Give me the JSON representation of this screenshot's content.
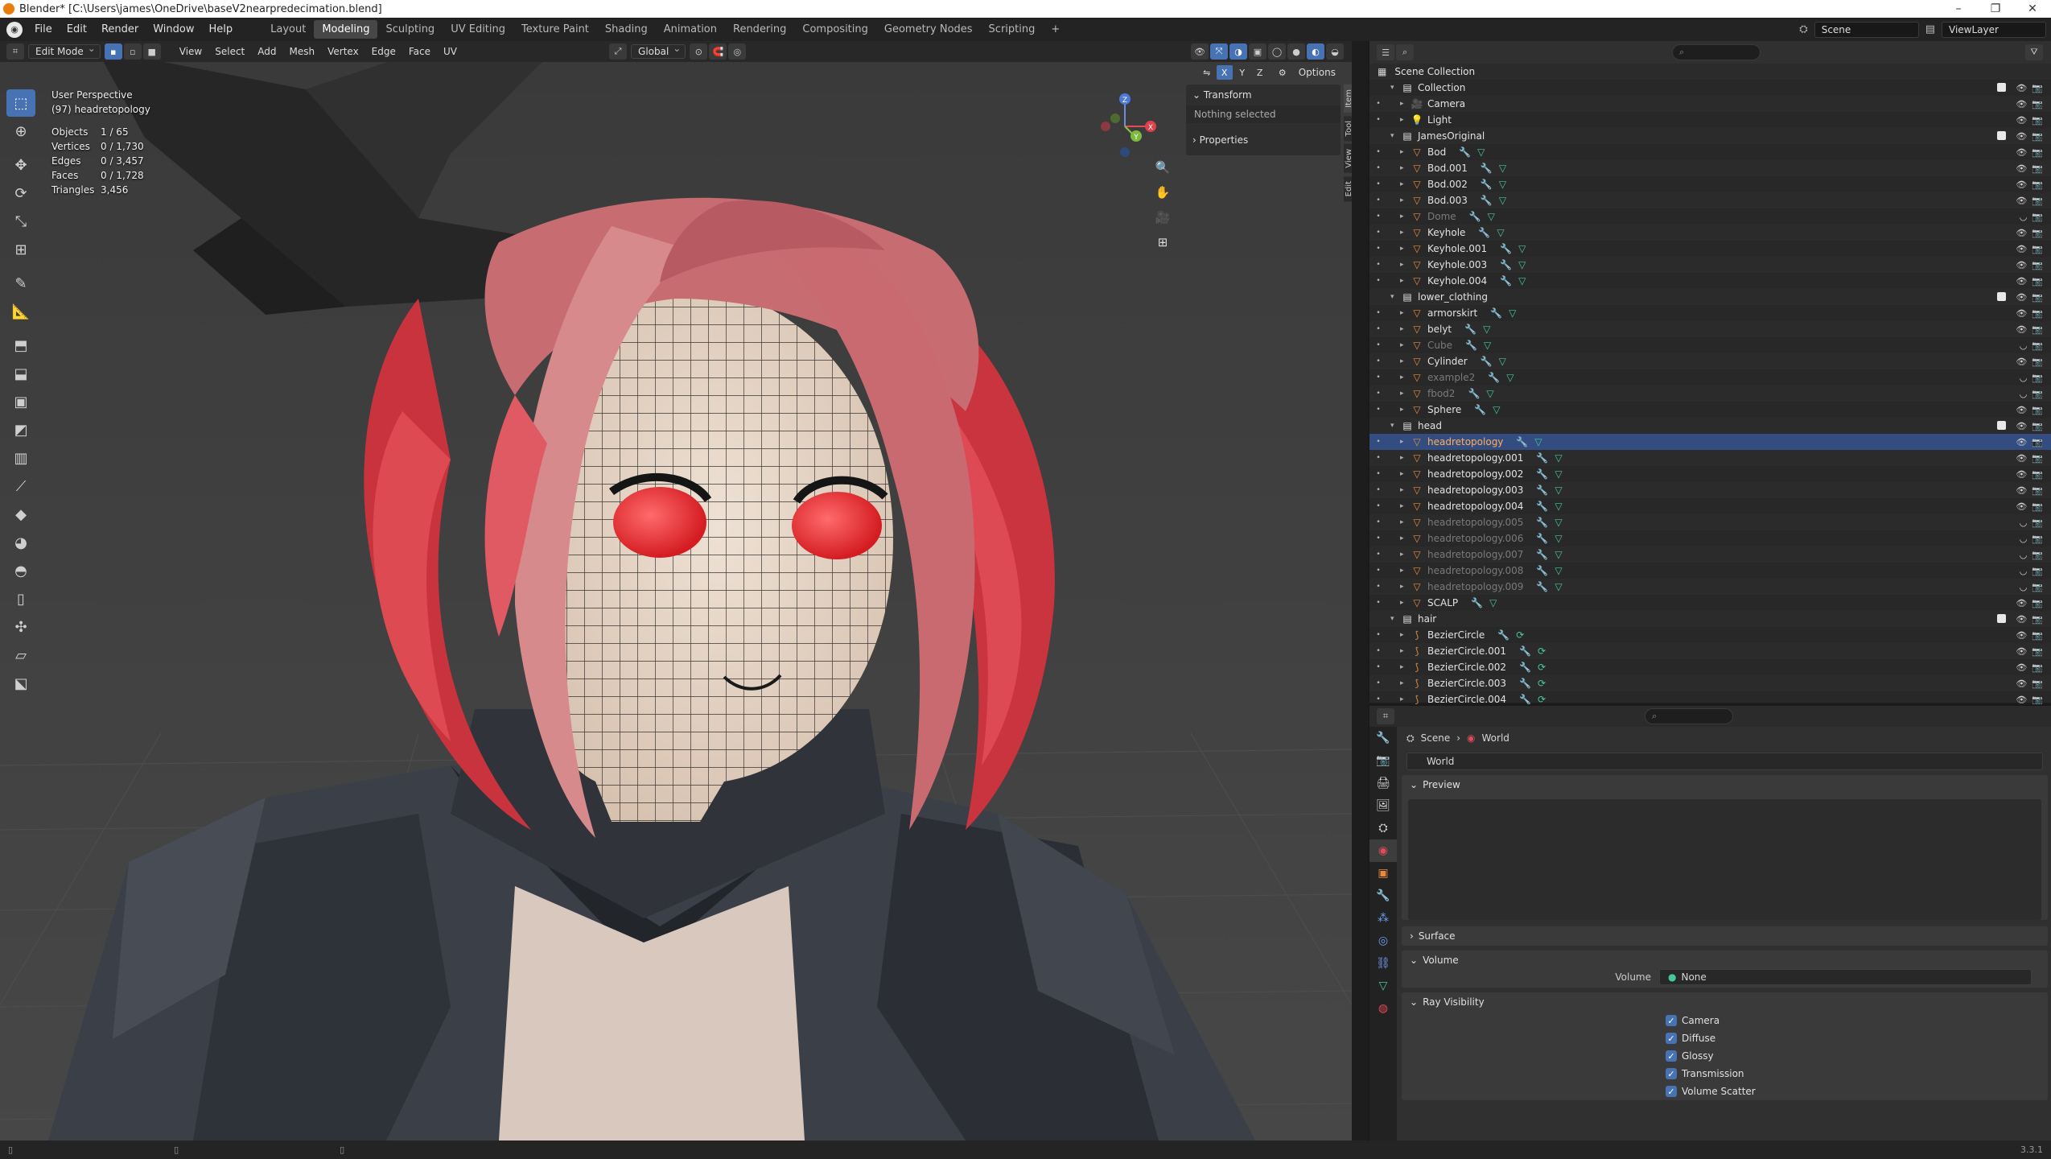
{
  "window": {
    "title": "Blender* [C:\\Users\\james\\OneDrive\\baseV2nearpredecimation.blend]",
    "min": "–",
    "max": "❐",
    "close": "✕"
  },
  "menu": [
    "File",
    "Edit",
    "Render",
    "Window",
    "Help"
  ],
  "workspaces": [
    "Layout",
    "Modeling",
    "Sculpting",
    "UV Editing",
    "Texture Paint",
    "Shading",
    "Animation",
    "Rendering",
    "Compositing",
    "Geometry Nodes",
    "Scripting"
  ],
  "active_workspace": "Modeling",
  "scene": "Scene",
  "view_layer": "ViewLayer",
  "viewport": {
    "mode": "Edit Mode",
    "menus": [
      "View",
      "Select",
      "Add",
      "Mesh",
      "Vertex",
      "Edge",
      "Face",
      "UV"
    ],
    "transform_orientation": "Global",
    "options": "Options",
    "axes": [
      "X",
      "Y",
      "Z"
    ],
    "perspective": "User Perspective",
    "object": "(97) headretopology",
    "stats": [
      {
        "label": "Objects",
        "value": "1 / 65"
      },
      {
        "label": "Vertices",
        "value": "0 / 1,730"
      },
      {
        "label": "Edges",
        "value": "0 / 3,457"
      },
      {
        "label": "Faces",
        "value": "0 / 1,728"
      },
      {
        "label": "Triangles",
        "value": "3,456"
      }
    ],
    "npanel": {
      "transform": "Transform",
      "nothing_selected": "Nothing selected",
      "properties": "Properties"
    },
    "ntabs": [
      "Item",
      "Tool",
      "View",
      "Edit"
    ],
    "gizmo": {
      "x": "X",
      "y": "Y",
      "z": "Z"
    }
  },
  "outliner": {
    "root": "Scene Collection",
    "rows": [
      {
        "name": "Collection",
        "type": "collection",
        "indent": 0
      },
      {
        "name": "Camera",
        "type": "camera",
        "indent": 1
      },
      {
        "name": "Light",
        "type": "light",
        "indent": 1
      },
      {
        "name": "JamesOriginal",
        "type": "collection",
        "indent": 0
      },
      {
        "name": "Bod",
        "type": "mesh",
        "indent": 1
      },
      {
        "name": "Bod.001",
        "type": "mesh",
        "indent": 1
      },
      {
        "name": "Bod.002",
        "type": "mesh",
        "indent": 1
      },
      {
        "name": "Bod.003",
        "type": "mesh",
        "indent": 1
      },
      {
        "name": "Dome",
        "type": "mesh",
        "indent": 1,
        "dim": true
      },
      {
        "name": "Keyhole",
        "type": "mesh",
        "indent": 1
      },
      {
        "name": "Keyhole.001",
        "type": "mesh",
        "indent": 1
      },
      {
        "name": "Keyhole.003",
        "type": "mesh",
        "indent": 1
      },
      {
        "name": "Keyhole.004",
        "type": "mesh",
        "indent": 1
      },
      {
        "name": "lower_clothing",
        "type": "collection",
        "indent": 0
      },
      {
        "name": "armorskirt",
        "type": "mesh",
        "indent": 1
      },
      {
        "name": "belyt",
        "type": "mesh",
        "indent": 1
      },
      {
        "name": "Cube",
        "type": "mesh",
        "indent": 1,
        "dim": true
      },
      {
        "name": "Cylinder",
        "type": "mesh",
        "indent": 1
      },
      {
        "name": "example2",
        "type": "mesh",
        "indent": 1,
        "dim": true
      },
      {
        "name": "fbod2",
        "type": "mesh",
        "indent": 1,
        "dim": true
      },
      {
        "name": "Sphere",
        "type": "mesh",
        "indent": 1
      },
      {
        "name": "head",
        "type": "collection",
        "indent": 0
      },
      {
        "name": "headretopology",
        "type": "mesh",
        "indent": 1,
        "selected": true
      },
      {
        "name": "headretopology.001",
        "type": "mesh",
        "indent": 1
      },
      {
        "name": "headretopology.002",
        "type": "mesh",
        "indent": 1
      },
      {
        "name": "headretopology.003",
        "type": "mesh",
        "indent": 1
      },
      {
        "name": "headretopology.004",
        "type": "mesh",
        "indent": 1
      },
      {
        "name": "headretopology.005",
        "type": "mesh",
        "indent": 1,
        "dim": true
      },
      {
        "name": "headretopology.006",
        "type": "mesh",
        "indent": 1,
        "dim": true
      },
      {
        "name": "headretopology.007",
        "type": "mesh",
        "indent": 1,
        "dim": true
      },
      {
        "name": "headretopology.008",
        "type": "mesh",
        "indent": 1,
        "dim": true
      },
      {
        "name": "headretopology.009",
        "type": "mesh",
        "indent": 1,
        "dim": true
      },
      {
        "name": "SCALP",
        "type": "mesh",
        "indent": 1
      },
      {
        "name": "hair",
        "type": "collection",
        "indent": 0
      },
      {
        "name": "BezierCircle",
        "type": "curve",
        "indent": 1
      },
      {
        "name": "BezierCircle.001",
        "type": "curve",
        "indent": 1
      },
      {
        "name": "BezierCircle.002",
        "type": "curve",
        "indent": 1
      },
      {
        "name": "BezierCircle.003",
        "type": "curve",
        "indent": 1
      },
      {
        "name": "BezierCircle.004",
        "type": "curve",
        "indent": 1
      }
    ]
  },
  "properties": {
    "breadcrumb": [
      "Scene",
      "World"
    ],
    "world_name": "World",
    "panels": {
      "preview": "Preview",
      "surface": "Surface",
      "volume": "Volume",
      "ray_visibility": "Ray Visibility"
    },
    "volume_label": "Volume",
    "volume_value": "None",
    "ray_visibility": [
      "Camera",
      "Diffuse",
      "Glossy",
      "Transmission",
      "Volume Scatter"
    ]
  },
  "statusbar": {
    "version": "3.3.1"
  },
  "colors": {
    "accent": "#4772b3",
    "selected_row": "#334d80",
    "active_name": "#ffae5c",
    "hair": "#d8454c",
    "skin": "#e6d6c6",
    "mesh_icon": "#e88a3c",
    "data_icon": "#46c79c"
  }
}
